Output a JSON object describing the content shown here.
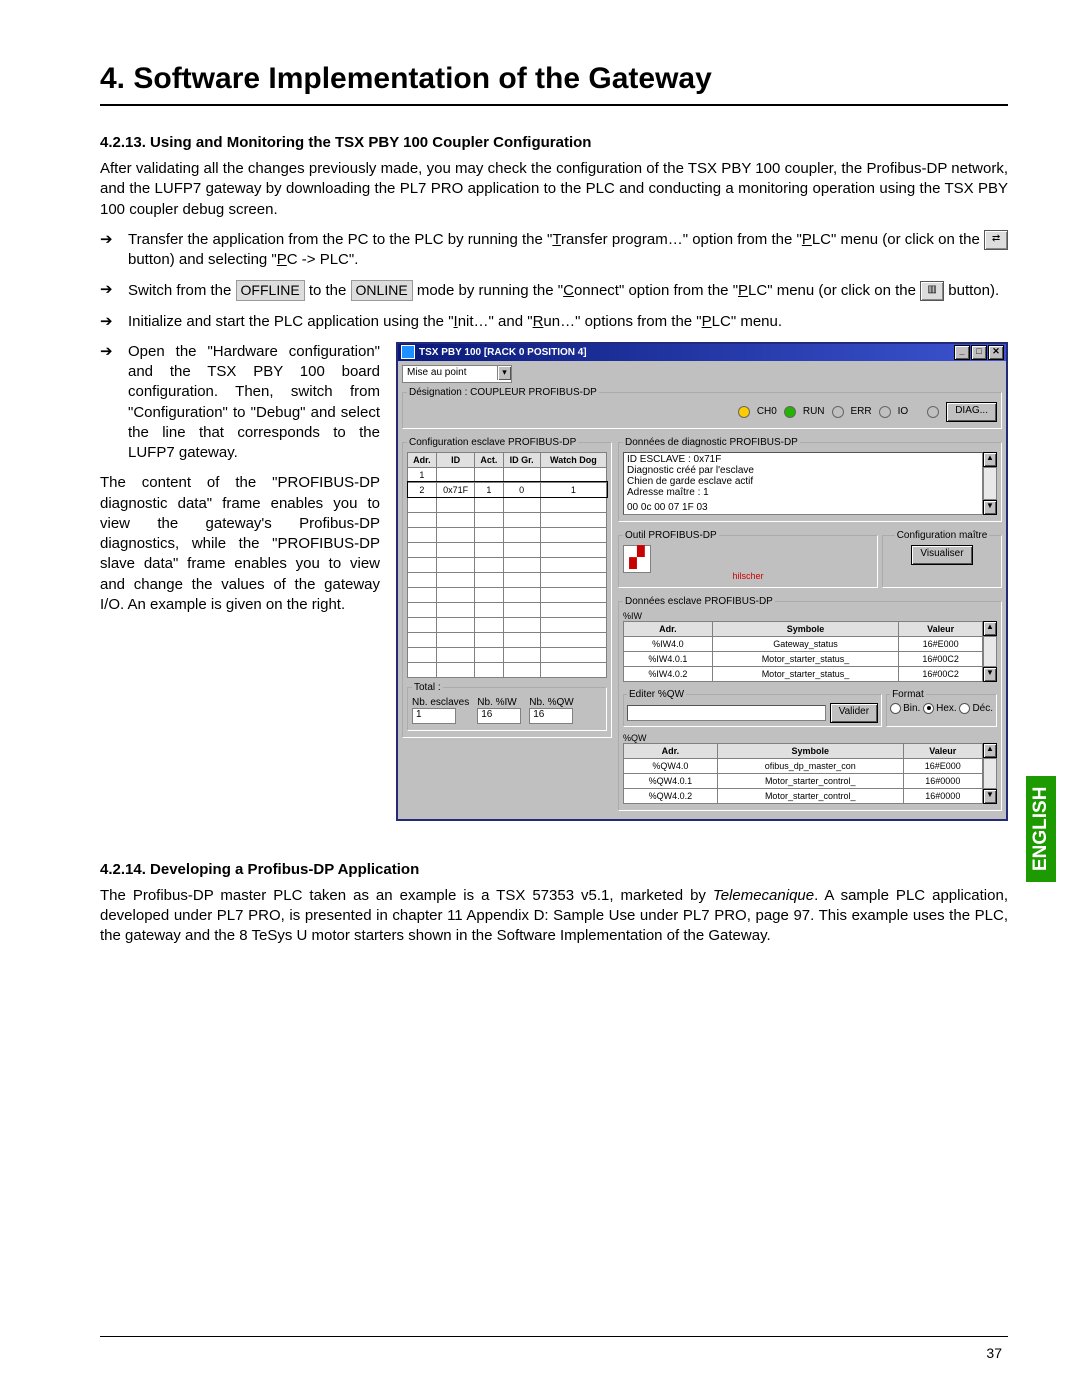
{
  "chapter_title": "4. Software Implementation of the Gateway",
  "section1_title": "4.2.13. Using and Monitoring the TSX PBY 100 Coupler Configuration",
  "intro_para": "After validating all the changes previously made, you may check the configuration of the TSX PBY 100 coupler, the Profibus-DP network, and the LUFP7 gateway by downloading the PL7 PRO application to the PLC and conducting a monitoring operation using the TSX PBY 100 coupler debug screen.",
  "bullet1a": "Transfer the application from the PC to the PLC by running the \"",
  "bullet1_u1": "T",
  "bullet1b": "ransfer program…\" option from the \"",
  "bullet1_u2": "P",
  "bullet1c": "LC\" menu (or click on the ",
  "bullet1d": " button) and selecting \"",
  "bullet1_u3": "P",
  "bullet1e": "C -> PLC\".",
  "bullet2a": "Switch from the ",
  "mode_off": "OFFLINE",
  "bullet2b": " to the ",
  "mode_on": "ONLINE",
  "bullet2c": " mode by running the \"",
  "bullet2_u1": "C",
  "bullet2d": "onnect\" option from the \"",
  "bullet2_u2": "P",
  "bullet2e": "LC\" menu (or click on the ",
  "bullet2f": " button).",
  "bullet3a": "Initialize and start the PLC application using the \"",
  "bullet3_u1": "I",
  "bullet3b": "nit…\" and \"",
  "bullet3_u2": "R",
  "bullet3c": "un…\" options from the \"",
  "bullet3_u3": "P",
  "bullet3d": "LC\" menu.",
  "bullet4": "Open the \"Hardware configuration\" and the TSX PBY 100 board configuration. Then, switch from \"Configuration\" to \"Debug\" and select the line that corresponds to the LUFP7 gateway.",
  "left_para": "The content of the \"PROFIBUS-DP diagnostic data\" frame enables you to view the gateway's Profibus-DP diagnostics, while the \"PROFIBUS-DP slave data\" frame enables you to view and change the values of the gateway I/O. An example is given on the right.",
  "dialog": {
    "title": "TSX PBY 100 [RACK 0      POSITION 4]",
    "mode_label": "Mise au point",
    "designation_label": "Désignation : COUPLEUR PROFIBUS-DP",
    "ch0": "CH0",
    "run": "RUN",
    "err": "ERR",
    "io": "IO",
    "diag_btn": "DIAG...",
    "slave_cfg_legend": "Configuration esclave PROFIBUS-DP",
    "th_adr": "Adr.",
    "th_id": "ID",
    "th_act": "Act.",
    "th_idgr": "ID Gr.",
    "th_wd": "Watch Dog",
    "row1": "1",
    "row2": "2",
    "row_id": "0x71F",
    "row_act": "1",
    "row_idgr": "0",
    "row_wd": "1",
    "totals_label": "Total :",
    "totals_esc": "Nb. esclaves",
    "totals_iw": "Nb. %IW",
    "totals_qw": "Nb. %QW",
    "totals_esc_v": "1",
    "totals_iw_v": "16",
    "totals_qw_v": "16",
    "diag_legend": "Données de diagnostic PROFIBUS-DP",
    "diag_l1": "ID ESCLAVE : 0x71F",
    "diag_l2": "Diagnostic créé par l'esclave",
    "diag_l3": "Chien de garde esclave actif",
    "diag_l4": "Adresse maître : 1",
    "diag_l5": "00 0c 00 07 1F 03",
    "outil_legend": "Outil PROFIBUS-DP",
    "cfg_maitre": "Configuration maître",
    "visualiser": "Visualiser",
    "hilscher": "hilscher",
    "sd_legend": "Données esclave PROFIBUS-DP",
    "iw_lbl": "%IW",
    "th2_adr": "Adr.",
    "th2_sym": "Symbole",
    "th2_val": "Valeur",
    "iw_r1_a": "%IW4.0",
    "iw_r1_s": "Gateway_status",
    "iw_r1_v": "16#E000",
    "iw_r2_a": "%IW4.0.1",
    "iw_r2_s": "Motor_starter_status_",
    "iw_r2_v": "16#00C2",
    "iw_r3_a": "%IW4.0.2",
    "iw_r3_s": "Motor_starter_status_",
    "iw_r3_v": "16#00C2",
    "editer_lbl": "Editer %QW",
    "valider": "Valider",
    "format": "Format",
    "bin": "Bin.",
    "hex": "Hex.",
    "dec": "Déc.",
    "qw_lbl": "%QW",
    "qw_r1_a": "%QW4.0",
    "qw_r1_s": "ofibus_dp_master_con",
    "qw_r1_v": "16#E000",
    "qw_r2_a": "%QW4.0.1",
    "qw_r2_s": "Motor_starter_control_",
    "qw_r2_v": "16#0000",
    "qw_r3_a": "%QW4.0.2",
    "qw_r3_s": "Motor_starter_control_",
    "qw_r3_v": "16#0000"
  },
  "section2_title": "4.2.14. Developing a Profibus-DP Application",
  "section2_p_a": "The Profibus-DP master PLC taken as an example is a TSX 57353 v5.1, marketed by ",
  "section2_p_em": "Telemecanique",
  "section2_p_b": ". A sample PLC application, developed under PL7 PRO, is presented in chapter 11 Appendix D: Sample Use under PL7 PRO, page 97. This example uses the PLC, the gateway and the 8 TeSys U motor starters shown in the Software Implementation of the Gateway.",
  "page_number": "37",
  "lang_tab": "ENGLISH"
}
